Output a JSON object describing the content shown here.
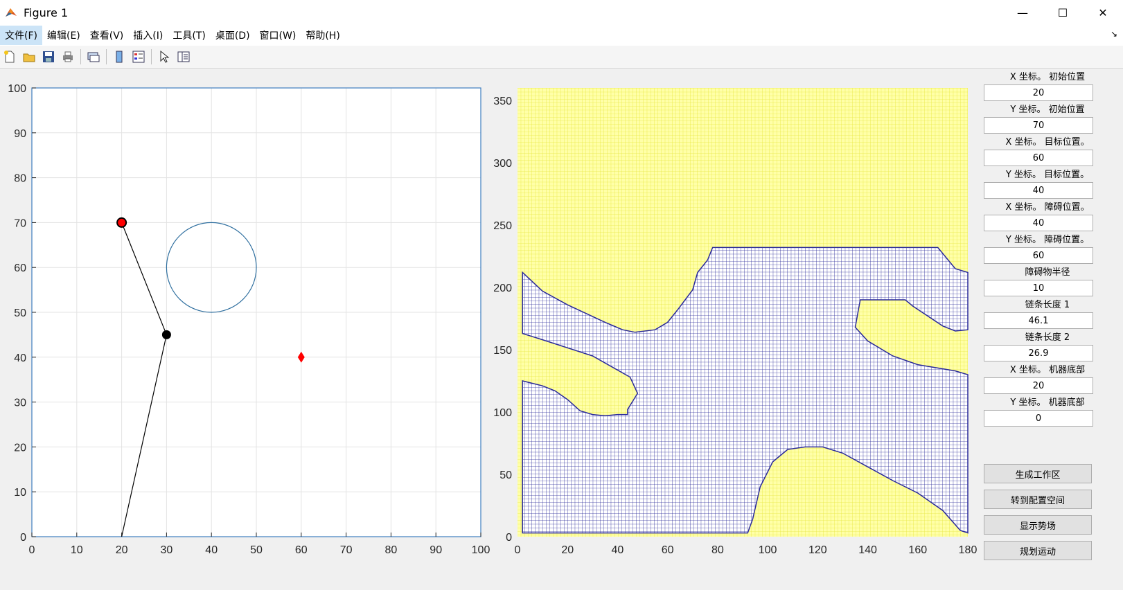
{
  "window": {
    "title": "Figure 1",
    "minimize": "—",
    "maximize": "☐",
    "close": "✕"
  },
  "menu": {
    "items": [
      "文件(F)",
      "编辑(E)",
      "查看(V)",
      "插入(I)",
      "工具(T)",
      "桌面(D)",
      "窗口(W)",
      "帮助(H)"
    ],
    "corner": "↘"
  },
  "toolbar": {
    "icons": [
      "new-figure-icon",
      "open-file-icon",
      "save-icon",
      "print-icon",
      "link-icon",
      "colorbar-icon",
      "legend-icon",
      "pointer-icon",
      "property-editor-icon"
    ]
  },
  "colors": {
    "axis_line": "#3c7dbf",
    "circle": "#2f6f9f",
    "arm": "#000000",
    "marker_start": "#ff0000",
    "marker_target": "#ff0000",
    "free_space": "#ffffa8",
    "free_grid": "#e8e840",
    "obstacle_space": "#ffffff",
    "obstacle_grid": "#2a2a9a"
  },
  "chart_data": [
    {
      "type": "line",
      "title": "",
      "xlabel": "",
      "ylabel": "",
      "xlim": [
        0,
        100
      ],
      "ylim": [
        0,
        100
      ],
      "grid": true,
      "x_ticks": [
        0,
        10,
        20,
        30,
        40,
        50,
        60,
        70,
        80,
        90,
        100
      ],
      "y_ticks": [
        0,
        10,
        20,
        30,
        40,
        50,
        60,
        70,
        80,
        90,
        100
      ],
      "series": [
        {
          "kind": "arm",
          "x": [
            20,
            30,
            20
          ],
          "y": [
            0,
            45,
            70
          ]
        }
      ],
      "joint": {
        "x": 30,
        "y": 45
      },
      "start": {
        "x": 20,
        "y": 70
      },
      "target": {
        "x": 60,
        "y": 40
      },
      "obstacle": {
        "cx": 40,
        "cy": 60,
        "r": 10
      }
    },
    {
      "type": "heatmap",
      "title": "",
      "xlabel": "",
      "ylabel": "",
      "xlim": [
        0,
        180
      ],
      "ylim": [
        0,
        360
      ],
      "x_ticks": [
        0,
        20,
        40,
        60,
        80,
        100,
        120,
        140,
        160,
        180
      ],
      "y_ticks": [
        0,
        50,
        100,
        150,
        200,
        250,
        300,
        350
      ],
      "obstacle_regions": [
        [
          [
            2,
            212
          ],
          [
            2,
            163
          ],
          [
            10,
            158
          ],
          [
            30,
            145
          ],
          [
            45,
            128
          ],
          [
            48,
            115
          ],
          [
            44,
            102
          ],
          [
            44,
            98
          ],
          [
            40,
            98
          ],
          [
            35,
            97
          ],
          [
            30,
            98
          ],
          [
            25,
            101
          ],
          [
            20,
            110
          ],
          [
            15,
            117
          ],
          [
            10,
            121
          ],
          [
            2,
            125
          ],
          [
            2,
            3
          ],
          [
            92,
            3
          ],
          [
            94,
            14
          ],
          [
            97,
            40
          ],
          [
            102,
            60
          ],
          [
            108,
            70
          ],
          [
            115,
            72
          ],
          [
            122,
            72
          ],
          [
            130,
            67
          ],
          [
            140,
            56
          ],
          [
            150,
            45
          ],
          [
            160,
            35
          ],
          [
            170,
            21
          ],
          [
            177,
            5
          ],
          [
            180,
            3
          ],
          [
            180,
            130
          ],
          [
            175,
            133
          ],
          [
            160,
            138
          ],
          [
            150,
            145
          ],
          [
            140,
            157
          ],
          [
            135,
            168
          ],
          [
            137,
            190
          ],
          [
            155,
            190
          ],
          [
            158,
            185
          ],
          [
            170,
            169
          ],
          [
            175,
            165
          ],
          [
            180,
            166
          ],
          [
            180,
            212
          ],
          [
            175,
            215
          ],
          [
            168,
            232
          ],
          [
            78,
            232
          ],
          [
            76,
            222
          ],
          [
            72,
            212
          ],
          [
            70,
            198
          ],
          [
            64,
            182
          ],
          [
            60,
            172
          ],
          [
            55,
            166
          ],
          [
            47,
            164
          ],
          [
            42,
            166
          ],
          [
            35,
            172
          ],
          [
            20,
            186
          ],
          [
            10,
            197
          ],
          [
            2,
            212
          ]
        ]
      ]
    }
  ],
  "panel": {
    "fields": [
      {
        "label": "X 坐标。 初始位置",
        "value": "20"
      },
      {
        "label": "Y 坐标。 初始位置",
        "value": "70"
      },
      {
        "label": "X 坐标。 目标位置。",
        "value": "60"
      },
      {
        "label": "Y 坐标。 目标位置。",
        "value": "40"
      },
      {
        "label": "X 坐标。 障碍位置。",
        "value": "40"
      },
      {
        "label": "Y 坐标。 障碍位置。",
        "value": "60"
      },
      {
        "label": "障碍物半径",
        "value": "10"
      },
      {
        "label": "链条长度 1",
        "value": "46.1"
      },
      {
        "label": "链条长度 2",
        "value": "26.9"
      },
      {
        "label": "X 坐标。 机器底部",
        "value": "20"
      },
      {
        "label": "Y 坐标。 机器底部",
        "value": "0"
      }
    ],
    "buttons": [
      "生成工作区",
      "转到配置空间",
      "显示势场",
      "规划运动"
    ]
  }
}
